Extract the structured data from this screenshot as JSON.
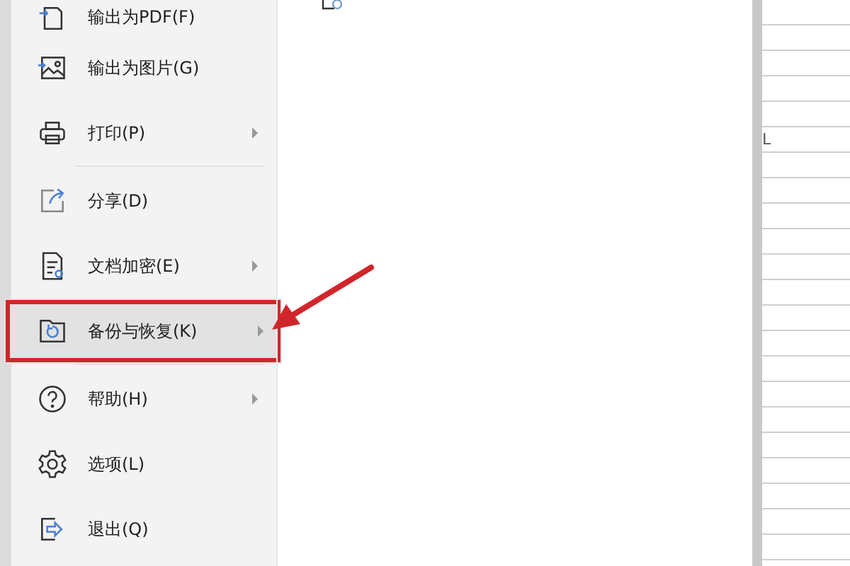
{
  "menu": {
    "items": [
      {
        "kind": "pdf",
        "label": "输出为PDF(F)",
        "submenu": false,
        "selected": false,
        "divider_after": false
      },
      {
        "kind": "image",
        "label": "输出为图片(G)",
        "submenu": false,
        "selected": false,
        "divider_after": false
      },
      {
        "kind": "print",
        "label": "打印(P)",
        "submenu": true,
        "selected": false,
        "divider_after": true
      },
      {
        "kind": "share",
        "label": "分享(D)",
        "submenu": false,
        "selected": false,
        "divider_after": false
      },
      {
        "kind": "encrypt",
        "label": "文档加密(E)",
        "submenu": true,
        "selected": false,
        "divider_after": false
      },
      {
        "kind": "backup",
        "label": "备份与恢复(K)",
        "submenu": true,
        "selected": true,
        "divider_after": true
      },
      {
        "kind": "help",
        "label": "帮助(H)",
        "submenu": true,
        "selected": false,
        "divider_after": false
      },
      {
        "kind": "settings",
        "label": "选项(L)",
        "submenu": false,
        "selected": false,
        "divider_after": false
      },
      {
        "kind": "exit",
        "label": "退出(Q)",
        "submenu": false,
        "selected": false,
        "divider_after": false
      }
    ]
  },
  "sheet": {
    "cell_text": "L"
  }
}
